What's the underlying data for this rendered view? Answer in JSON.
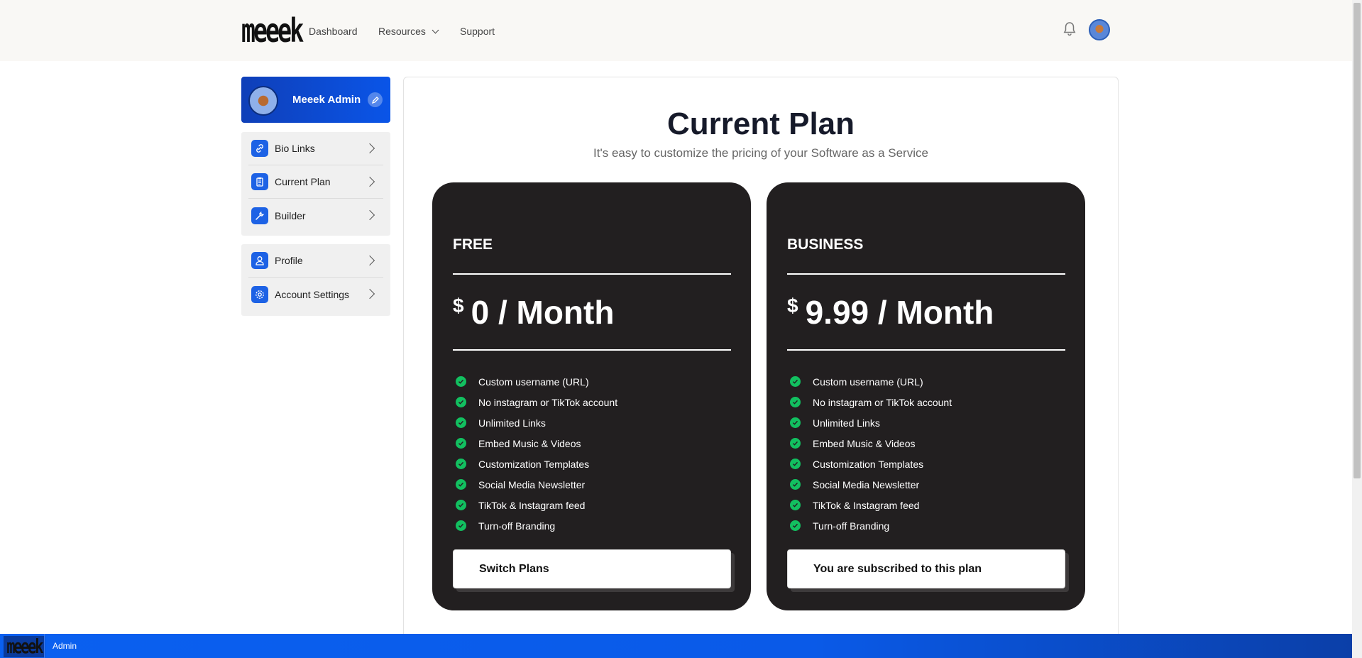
{
  "header": {
    "logo_text": "meeek",
    "nav": {
      "dashboard": "Dashboard",
      "resources": "Resources",
      "support": "Support"
    }
  },
  "sidebar": {
    "profile_name": "Meeek Admin",
    "group1": [
      {
        "label": "Bio Links",
        "icon": "link-icon"
      },
      {
        "label": "Current Plan",
        "icon": "clipboard-icon"
      },
      {
        "label": "Builder",
        "icon": "wrench-icon"
      }
    ],
    "group2": [
      {
        "label": "Profile",
        "icon": "user-icon"
      },
      {
        "label": "Account Settings",
        "icon": "gear-icon"
      }
    ]
  },
  "main": {
    "title": "Current Plan",
    "subtitle": "It's easy to customize the pricing of your Software as a Service",
    "plans": [
      {
        "name": "FREE",
        "currency": "$",
        "price": "0 / Month",
        "features": [
          "Custom username (URL)",
          "No instagram or TikTok account",
          "Unlimited Links",
          "Embed Music & Videos",
          "Customization Templates",
          "Social Media Newsletter",
          "TikTok & Instagram feed",
          "Turn-off Branding"
        ],
        "button": "Switch Plans"
      },
      {
        "name": "BUSINESS",
        "currency": "$",
        "price": "9.99 / Month",
        "features": [
          "Custom username (URL)",
          "No instagram or TikTok account",
          "Unlimited Links",
          "Embed Music & Videos",
          "Customization Templates",
          "Social Media Newsletter",
          "TikTok & Instagram feed",
          "Turn-off Branding"
        ],
        "button": "You are subscribed to this plan"
      }
    ]
  },
  "bottombar": {
    "logo_text": "meeek",
    "label": "Admin"
  },
  "colors": {
    "accent": "#0a5ae8",
    "card_bg": "#221f20",
    "check": "#12c060"
  }
}
